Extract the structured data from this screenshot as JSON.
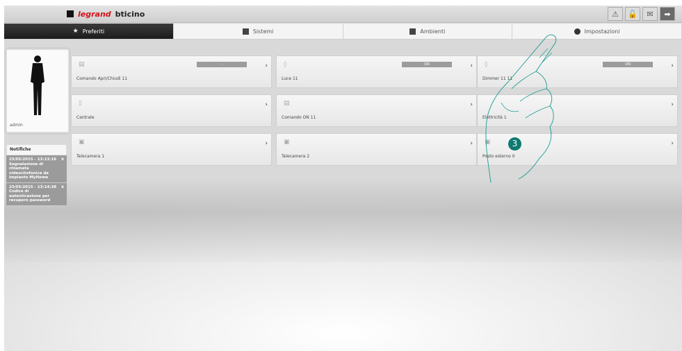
{
  "header": {
    "logo": {
      "brand1": "legrand",
      "brand2": "bticino"
    },
    "icons": [
      {
        "name": "alert-icon",
        "glyph": "⚠"
      },
      {
        "name": "lock-icon",
        "glyph": "🔓"
      },
      {
        "name": "mail-icon",
        "glyph": "✉"
      },
      {
        "name": "logout-icon",
        "glyph": "➡"
      }
    ]
  },
  "tabs": [
    {
      "label": "Preferiti",
      "active": true
    },
    {
      "label": "Sistemi",
      "active": false
    },
    {
      "label": "Ambienti",
      "active": false
    },
    {
      "label": "Impostazioni",
      "active": false
    }
  ],
  "profile": {
    "username": "admin"
  },
  "notifications": {
    "title": "Notifiche",
    "items": [
      {
        "text": "25/05/2015 - 13:13:16 Segnalazione di chiamata videocitofonica da impianto MyHome"
      },
      {
        "text": "25/05/2015 - 13:14:38 Codice di autenticazione per recupero password"
      }
    ]
  },
  "tiles": [
    {
      "label": "Comando Apri/Chiudi 11",
      "status": "-",
      "icon": "shutter-icon"
    },
    {
      "label": "Luce 11",
      "status": "ON",
      "icon": "light-drop-icon"
    },
    {
      "label": "Dimmer 11 11",
      "status": "ON",
      "icon": "light-drop-icon"
    },
    {
      "label": "Centrale",
      "status": "",
      "icon": "thermometer-icon"
    },
    {
      "label": "Comando ON 11",
      "status": "",
      "icon": "shutter-icon"
    },
    {
      "label": "Elettricità 1",
      "status": "",
      "icon": "energy-icon"
    },
    {
      "label": "Telecamera 1",
      "status": "",
      "icon": "camera-icon"
    },
    {
      "label": "Telecamera 2",
      "status": "",
      "icon": "camera-icon"
    },
    {
      "label": "Posto esterno 0",
      "status": "",
      "icon": "camera-icon"
    }
  ],
  "callout": {
    "number": "3"
  },
  "colors": {
    "accent": "#0f7a72",
    "nav_active": "#222222",
    "status_bar": "#9c9c9c"
  }
}
